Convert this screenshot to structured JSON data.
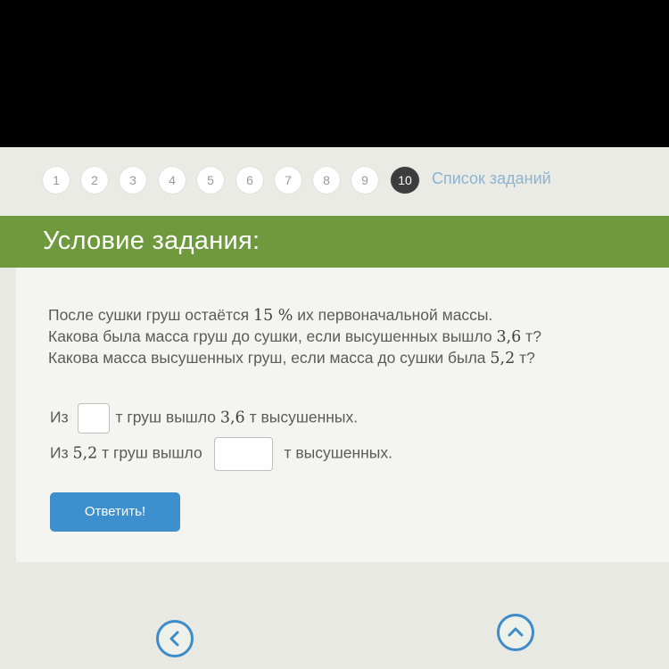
{
  "task_nav": {
    "numbers": [
      "1",
      "2",
      "3",
      "4",
      "5",
      "6",
      "7",
      "8",
      "9",
      "10"
    ],
    "active": "10",
    "list_link": "Список заданий"
  },
  "header": {
    "title": "Условие задания:"
  },
  "problem": {
    "line1_a": "После сушки груш остаётся ",
    "line1_num": "15 %",
    "line1_b": " их первоначальной массы.",
    "line2_a": "Какова была масса груш до сушки, если высушенных вышло ",
    "line2_num": "3,6",
    "line2_b": " т?",
    "line3_a": "Какова масса высушенных груш, если масса до сушки была ",
    "line3_num": "5,2",
    "line3_b": " т?"
  },
  "answers": {
    "row1": {
      "prefix": "Из",
      "after_a": "т груш вышло ",
      "num": "3,6",
      "after_b": " т высушенных.",
      "value": ""
    },
    "row2": {
      "prefix": "Из ",
      "num": "5,2",
      "middle": " т груш вышло",
      "suffix": "т высушенных.",
      "value": ""
    }
  },
  "submit_label": "Ответить!",
  "colors": {
    "header_green": "#6e9a3d",
    "button_blue": "#3d8fcd",
    "active_task": "#3d3d3d",
    "link_blue": "#8db3cf"
  },
  "icons": [
    "chevron-left-icon",
    "chevron-up-icon"
  ]
}
